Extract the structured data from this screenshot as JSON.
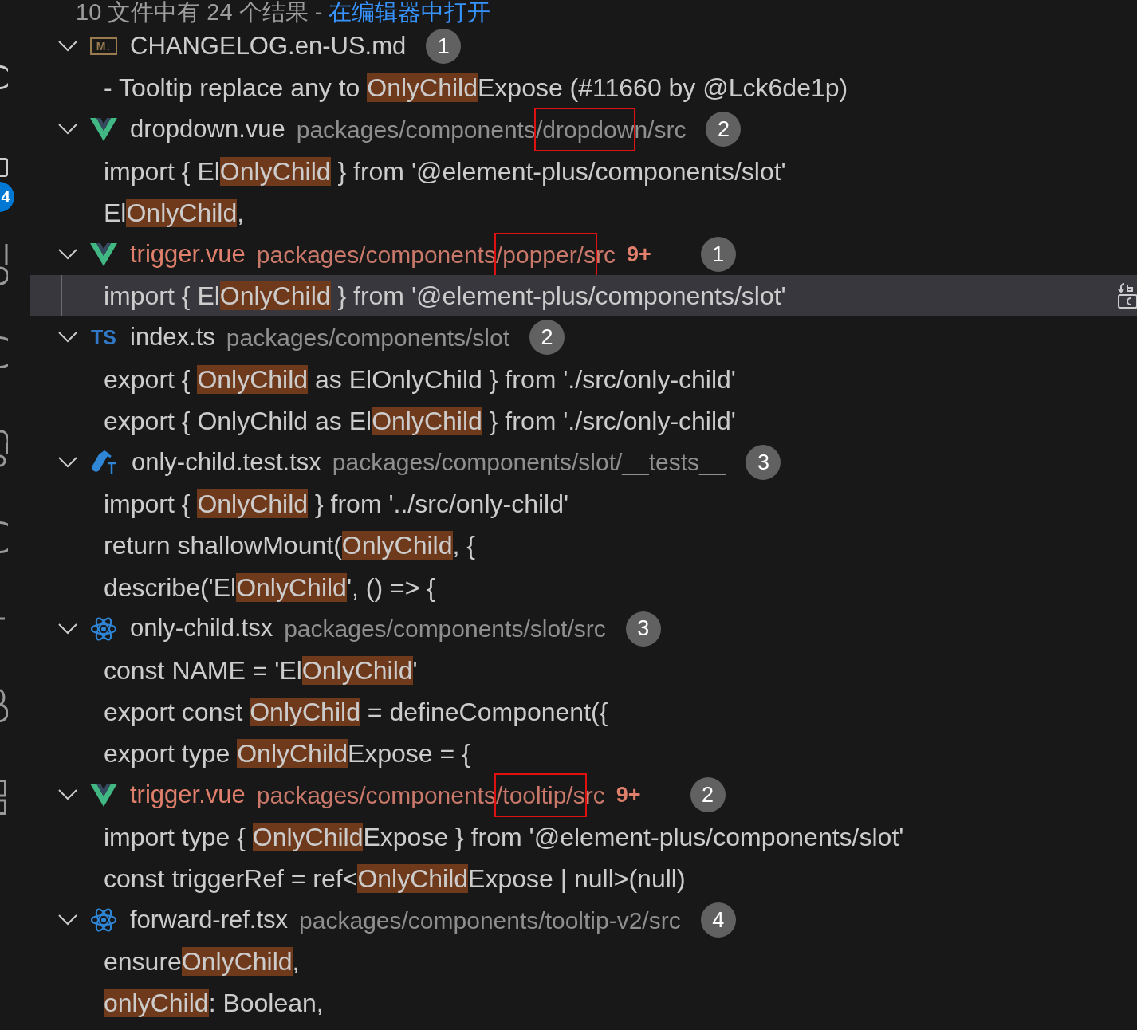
{
  "header": {
    "summary": "10 文件中有 24 个结果 - ",
    "link": "在编辑器中打开"
  },
  "activity_bar": {
    "badge": "4"
  },
  "files": [
    {
      "name": "CHANGELOG.en-US.md",
      "kind": "markdown",
      "icon_label": "M↓",
      "expanded": true,
      "modified": false,
      "count": "1",
      "lines": [
        {
          "selected": false,
          "parts": [
            {
              "text": "- Tooltip replace any to ",
              "match": false
            },
            {
              "text": "OnlyChild",
              "match": true
            },
            {
              "text": "Expose (#11660 by @Lck6de1p)",
              "match": false
            }
          ]
        }
      ]
    },
    {
      "name": "dropdown.vue",
      "kind": "vue",
      "expanded": true,
      "modified": false,
      "path": [
        {
          "text": "packages/components",
          "boxed": false
        },
        {
          "text": "/dropdow",
          "boxed": true
        },
        {
          "text": "n/src",
          "boxed": false
        }
      ],
      "count": "2",
      "lines": [
        {
          "selected": false,
          "parts": [
            {
              "text": "import { El",
              "match": false
            },
            {
              "text": "OnlyChild",
              "match": true
            },
            {
              "text": " } from '@element-plus/components/slot'",
              "match": false
            }
          ]
        },
        {
          "selected": false,
          "parts": [
            {
              "text": "El",
              "match": false
            },
            {
              "text": "OnlyChild",
              "match": true
            },
            {
              "text": ",",
              "match": false
            }
          ]
        }
      ]
    },
    {
      "name": "trigger.vue",
      "kind": "vue",
      "expanded": true,
      "modified": true,
      "path": [
        {
          "text": "packages/components",
          "boxed": false
        },
        {
          "text": "/popper/s",
          "boxed": true
        },
        {
          "text": "rc",
          "boxed": false
        }
      ],
      "problems": "9+",
      "count": "1",
      "lines": [
        {
          "selected": true,
          "parts": [
            {
              "text": "import { El",
              "match": false
            },
            {
              "text": "OnlyChild",
              "match": true
            },
            {
              "text": " } from '@element-plus/components/slot'",
              "match": false
            }
          ]
        }
      ]
    },
    {
      "name": "index.ts",
      "kind": "typescript",
      "icon_label": "TS",
      "expanded": true,
      "modified": false,
      "path": [
        {
          "text": "packages/components/slot",
          "boxed": false
        }
      ],
      "count": "2",
      "lines": [
        {
          "selected": false,
          "parts": [
            {
              "text": "export { ",
              "match": false
            },
            {
              "text": "OnlyChild",
              "match": true
            },
            {
              "text": " as ElOnlyChild } from './src/only-child'",
              "match": false
            }
          ]
        },
        {
          "selected": false,
          "parts": [
            {
              "text": "export { OnlyChild as El",
              "match": false
            },
            {
              "text": "OnlyChild",
              "match": true
            },
            {
              "text": " } from './src/only-child'",
              "match": false
            }
          ]
        }
      ]
    },
    {
      "name": "only-child.test.tsx",
      "kind": "test",
      "expanded": true,
      "modified": false,
      "path": [
        {
          "text": "packages/components/slot/__tests__",
          "boxed": false
        }
      ],
      "count": "3",
      "lines": [
        {
          "selected": false,
          "parts": [
            {
              "text": "import { ",
              "match": false
            },
            {
              "text": "OnlyChild",
              "match": true
            },
            {
              "text": " } from '../src/only-child'",
              "match": false
            }
          ]
        },
        {
          "selected": false,
          "parts": [
            {
              "text": "return shallowMount(",
              "match": false
            },
            {
              "text": "OnlyChild",
              "match": true
            },
            {
              "text": ", {",
              "match": false
            }
          ]
        },
        {
          "selected": false,
          "parts": [
            {
              "text": "describe('El",
              "match": false
            },
            {
              "text": "OnlyChild",
              "match": true
            },
            {
              "text": "', () => {",
              "match": false
            }
          ]
        }
      ]
    },
    {
      "name": "only-child.tsx",
      "kind": "react",
      "expanded": true,
      "modified": false,
      "path": [
        {
          "text": "packages/components/slot/src",
          "boxed": false
        }
      ],
      "count": "3",
      "lines": [
        {
          "selected": false,
          "parts": [
            {
              "text": "const NAME = 'El",
              "match": false
            },
            {
              "text": "OnlyChild",
              "match": true
            },
            {
              "text": "'",
              "match": false
            }
          ]
        },
        {
          "selected": false,
          "parts": [
            {
              "text": "export const ",
              "match": false
            },
            {
              "text": "OnlyChild",
              "match": true
            },
            {
              "text": " = defineComponent({",
              "match": false
            }
          ]
        },
        {
          "selected": false,
          "parts": [
            {
              "text": "export type ",
              "match": false
            },
            {
              "text": "OnlyChild",
              "match": true
            },
            {
              "text": "Expose = {",
              "match": false
            }
          ]
        }
      ]
    },
    {
      "name": "trigger.vue",
      "kind": "vue",
      "expanded": true,
      "modified": true,
      "path": [
        {
          "text": "packages/components",
          "boxed": false
        },
        {
          "text": "/tooltip/s",
          "boxed": true
        },
        {
          "text": "rc",
          "boxed": false
        }
      ],
      "problems": "9+",
      "count": "2",
      "lines": [
        {
          "selected": false,
          "parts": [
            {
              "text": "import type { ",
              "match": false
            },
            {
              "text": "OnlyChild",
              "match": true
            },
            {
              "text": "Expose } from '@element-plus/components/slot'",
              "match": false
            }
          ]
        },
        {
          "selected": false,
          "parts": [
            {
              "text": "const triggerRef = ref<",
              "match": false
            },
            {
              "text": "OnlyChild",
              "match": true
            },
            {
              "text": "Expose | null>(null)",
              "match": false
            }
          ]
        }
      ]
    },
    {
      "name": "forward-ref.tsx",
      "kind": "react",
      "expanded": true,
      "modified": false,
      "path": [
        {
          "text": "packages/components/tooltip-v2/src",
          "boxed": false
        }
      ],
      "count": "4",
      "lines": [
        {
          "selected": false,
          "parts": [
            {
              "text": "ensure",
              "match": false
            },
            {
              "text": "OnlyChild",
              "match": true
            },
            {
              "text": ",",
              "match": false
            }
          ]
        },
        {
          "selected": false,
          "parts": [
            {
              "text": "onlyChild",
              "match": true
            },
            {
              "text": ": Boolean,",
              "match": false
            }
          ]
        }
      ]
    }
  ]
}
